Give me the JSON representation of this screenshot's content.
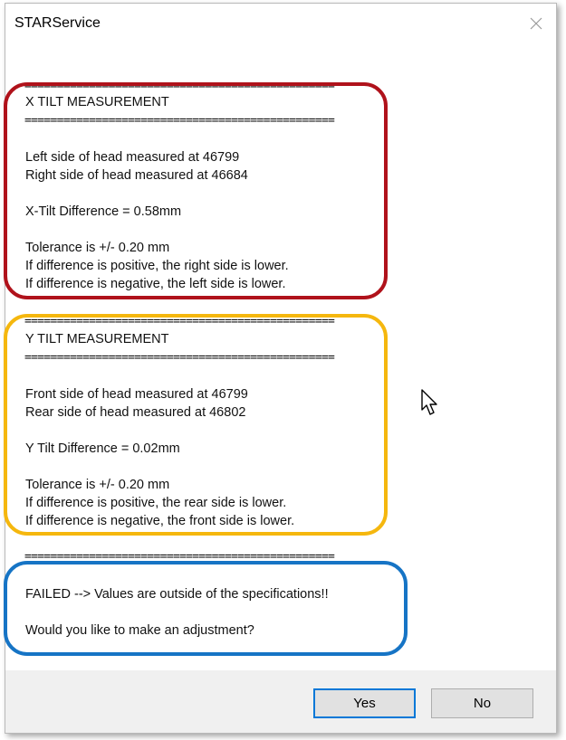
{
  "window": {
    "title": "STARService",
    "close_icon": "close-icon"
  },
  "content": {
    "separator": "================================================",
    "x_tilt": {
      "heading": "X TILT MEASUREMENT",
      "lines": [
        "Left side of head measured at 46799",
        "Right side of head measured at 46684",
        "X-Tilt Difference = 0.58mm",
        "Tolerance is +/- 0.20 mm",
        "If difference is positive, the right side is lower.",
        "If difference is negative, the left side is lower."
      ]
    },
    "y_tilt": {
      "heading": "Y TILT MEASUREMENT",
      "lines": [
        "Front side of head measured at 46799",
        "Rear side of head measured at 46802",
        "Y Tilt Difference = 0.02mm",
        "Tolerance is +/- 0.20 mm",
        "If difference is positive, the rear side is lower.",
        "If difference is negative, the front side is lower."
      ]
    },
    "result": {
      "status": "FAILED --> Values are outside of the specifications!!",
      "question": "Would you like to make an adjustment?"
    }
  },
  "annotations": {
    "x_tilt_box_color": "#b0121b",
    "y_tilt_box_color": "#f5b70e",
    "result_box_color": "#1674c5"
  },
  "buttons": {
    "yes_label": "Yes",
    "no_label": "No"
  },
  "colors": {
    "accent": "#0078d7",
    "footer_bg": "#f0f0f0"
  }
}
